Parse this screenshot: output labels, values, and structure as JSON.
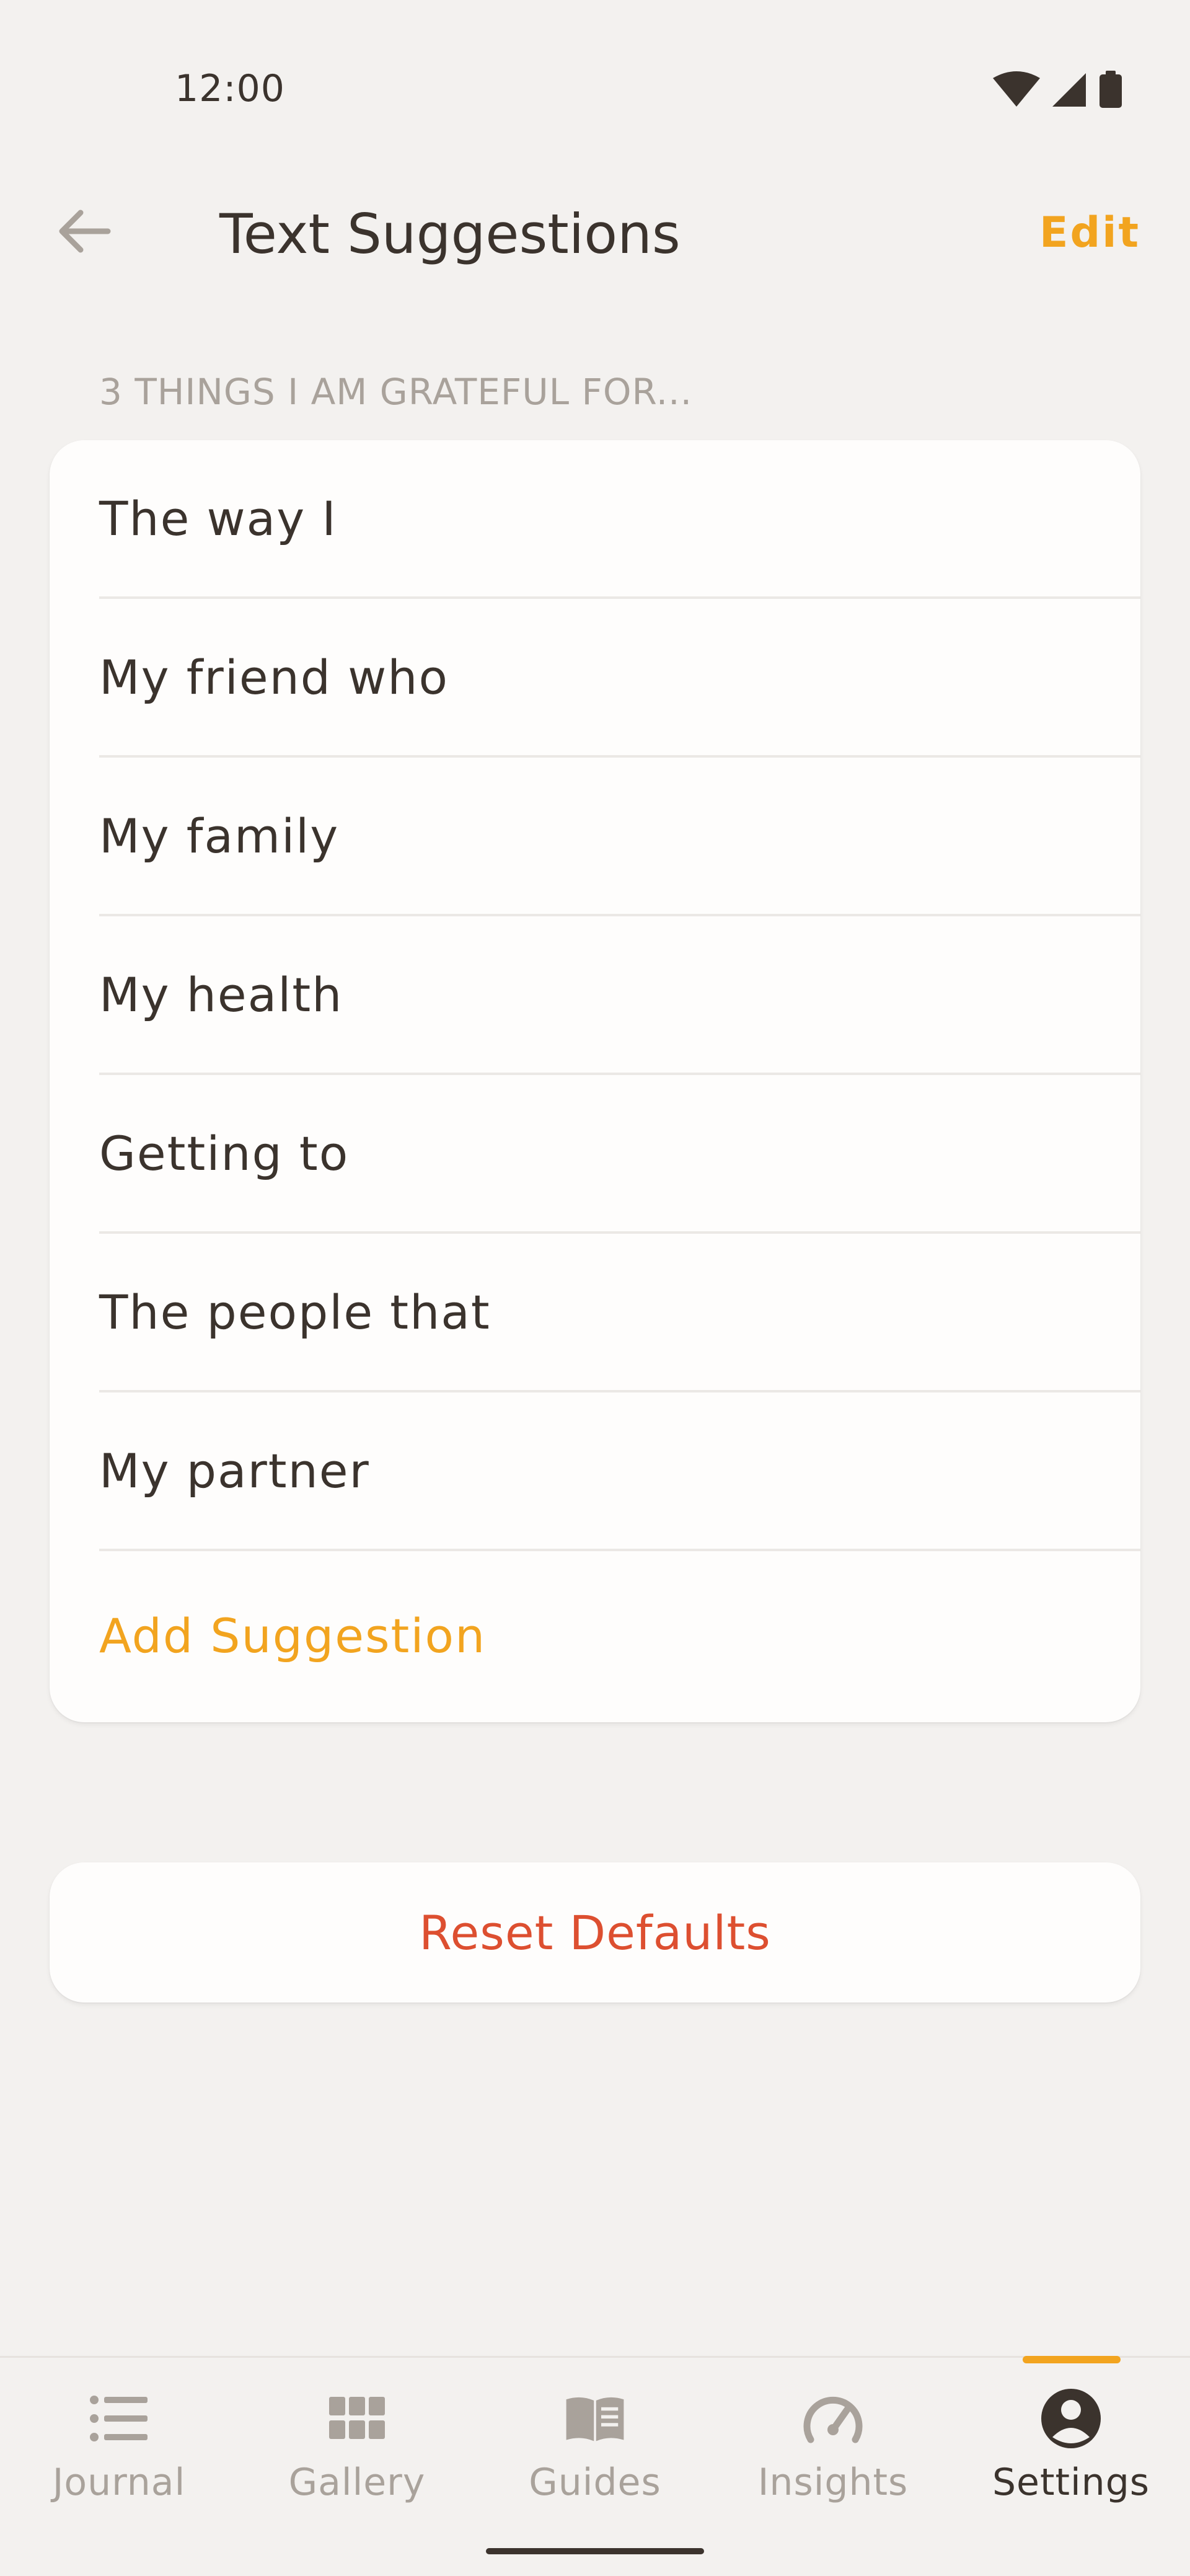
{
  "status_bar": {
    "time": "12:00"
  },
  "app_bar": {
    "title": "Text Suggestions",
    "edit_label": "Edit"
  },
  "section": {
    "header": "3 THINGS I AM GRATEFUL FOR..."
  },
  "suggestions": [
    {
      "label": "The way I"
    },
    {
      "label": "My friend who"
    },
    {
      "label": "My family"
    },
    {
      "label": "My health"
    },
    {
      "label": "Getting to"
    },
    {
      "label": "The people that"
    },
    {
      "label": "My partner"
    }
  ],
  "add_suggestion_label": "Add Suggestion",
  "reset_label": "Reset Defaults",
  "bottom_nav": {
    "active": "Settings",
    "items": [
      {
        "label": "Journal",
        "icon": "list-icon"
      },
      {
        "label": "Gallery",
        "icon": "grid-icon"
      },
      {
        "label": "Guides",
        "icon": "book-icon"
      },
      {
        "label": "Insights",
        "icon": "gauge-icon"
      },
      {
        "label": "Settings",
        "icon": "account-circle-icon"
      }
    ]
  },
  "colors": {
    "accent": "#f2a41f",
    "destructive": "#dd4f30",
    "background": "#f3f1ef",
    "card": "#fefdfc",
    "text_primary": "#3b332d",
    "text_muted": "#a9a29b"
  }
}
